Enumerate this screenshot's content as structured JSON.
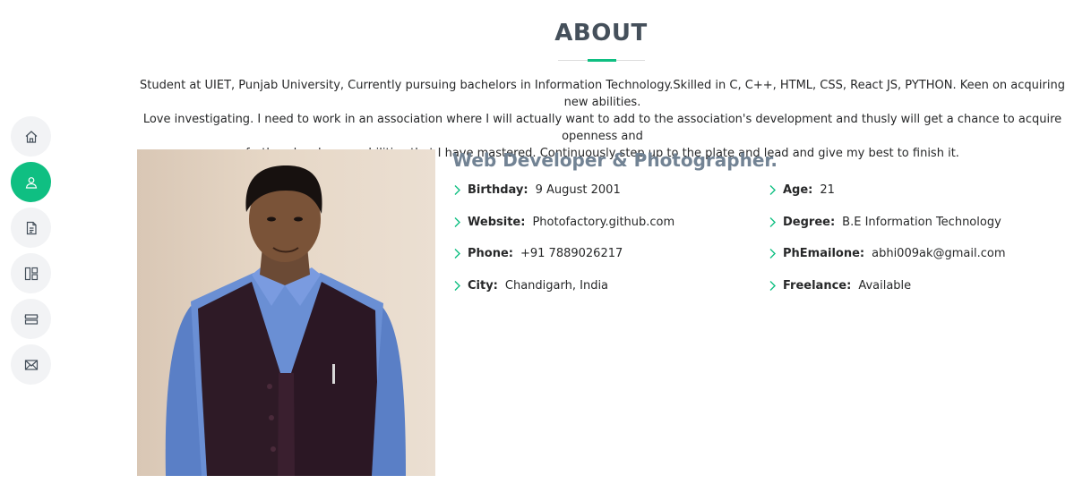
{
  "nav": {
    "items": [
      {
        "icon": "home-icon",
        "active": false
      },
      {
        "icon": "user-icon",
        "active": true
      },
      {
        "icon": "resume-icon",
        "active": false
      },
      {
        "icon": "portfolio-icon",
        "active": false
      },
      {
        "icon": "services-icon",
        "active": false
      },
      {
        "icon": "envelope-icon",
        "active": false
      }
    ],
    "accent_color": "#0fbf82"
  },
  "about": {
    "title": "ABOUT",
    "intro_lines": [
      "Student at UIET, Punjab University, Currently pursuing bachelors in Information Technology.Skilled in C, C++, HTML, CSS, React JS, PYTHON. Keen on acquiring new abilities.",
      "Love investigating. I need to work in an association where I will actually want to add to the association's development and thusly will get a chance to acquire openness and",
      "further develop my abilities that I have mastered. Continuously step up to the plate and lead and give my best to finish it."
    ],
    "role": "Web Developer & Photographer.",
    "info_left": [
      {
        "label": "Birthday:",
        "value": "9 August 2001"
      },
      {
        "label": "Website:",
        "value": "Photofactory.github.com"
      },
      {
        "label": "Phone:",
        "value": "+91 7889026217"
      },
      {
        "label": "City:",
        "value": "Chandigarh, India"
      }
    ],
    "info_right": [
      {
        "label": "Age:",
        "value": "21"
      },
      {
        "label": "Degree:",
        "value": "B.E Information Technology"
      },
      {
        "label": "PhEmailone:",
        "value": "abhi009ak@gmail.com"
      },
      {
        "label": "Freelance:",
        "value": "Available"
      }
    ]
  }
}
